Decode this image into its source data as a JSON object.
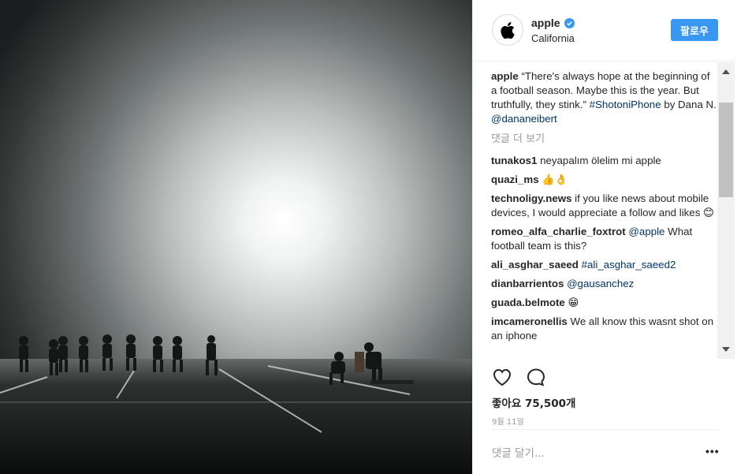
{
  "post": {
    "photo_alt": "Football players practicing in fog under stadium lights",
    "account": {
      "username": "apple",
      "location": "California",
      "follow_label": "팔로우"
    },
    "caption": {
      "user": "apple",
      "text": "“There's always hope at the beginning of a football season. Maybe this is the year. But truthfully, they stink.”",
      "hashtag": "#ShotoniPhone",
      "by_text": "by Dana N.",
      "mention": "@dananeibert"
    },
    "view_more": "댓글 더 보기",
    "comments": [
      {
        "user": "tunakos1",
        "link": "",
        "text": "neyapalım ölelim mi apple"
      },
      {
        "user": "quazi_ms",
        "link": "",
        "text": "👍👌"
      },
      {
        "user": "technoligy.news",
        "link": "",
        "text": "if you like news about mobile devices, I would appreciate a follow and likes 😊"
      },
      {
        "user": "romeo_alfa_charlie_foxtrot",
        "link": "@apple",
        "text": "What football team is this?"
      },
      {
        "user": "ali_asghar_saeed",
        "link": "#ali_asghar_saeed2",
        "text": ""
      },
      {
        "user": "dianbarrientos",
        "link": "@gausanchez",
        "text": ""
      },
      {
        "user": "guada.belmote",
        "link": "",
        "text": "😁"
      },
      {
        "user": "imcameronellis",
        "link": "",
        "text": "We all know this wasnt shot on an iphone"
      }
    ],
    "likes": "좋아요 75,500개",
    "date": "9월 11일",
    "add_comment_placeholder": "댓글 달기...",
    "more_options": "•••",
    "icons": {
      "like": "heart-icon",
      "comment": "comment-bubble-icon",
      "avatar": "apple-logo-icon",
      "verified": "verified-badge-icon"
    },
    "colors": {
      "follow_button": "#3897f0",
      "link": "#003569",
      "muted": "#999999"
    }
  }
}
